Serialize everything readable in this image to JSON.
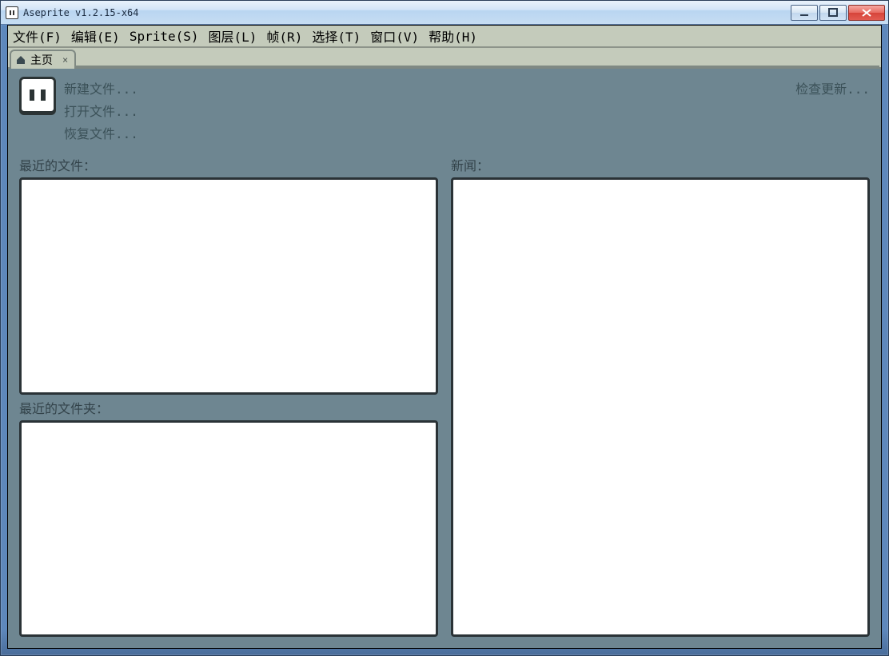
{
  "window": {
    "title": "Aseprite v1.2.15-x64"
  },
  "menu": {
    "file": "文件(F)",
    "edit": "编辑(E)",
    "sprite": "Sprite(S)",
    "layer": "图层(L)",
    "frame": "帧(R)",
    "select": "选择(T)",
    "window": "窗口(V)",
    "help": "帮助(H)"
  },
  "tab": {
    "home_label": "主页"
  },
  "home": {
    "new_file": "新建文件...",
    "open_file": "打开文件...",
    "recover_file": "恢复文件...",
    "check_updates": "检查更新...",
    "recent_files_label": "最近的文件：",
    "recent_folders_label": "最近的文件夹：",
    "news_label": "新闻："
  }
}
